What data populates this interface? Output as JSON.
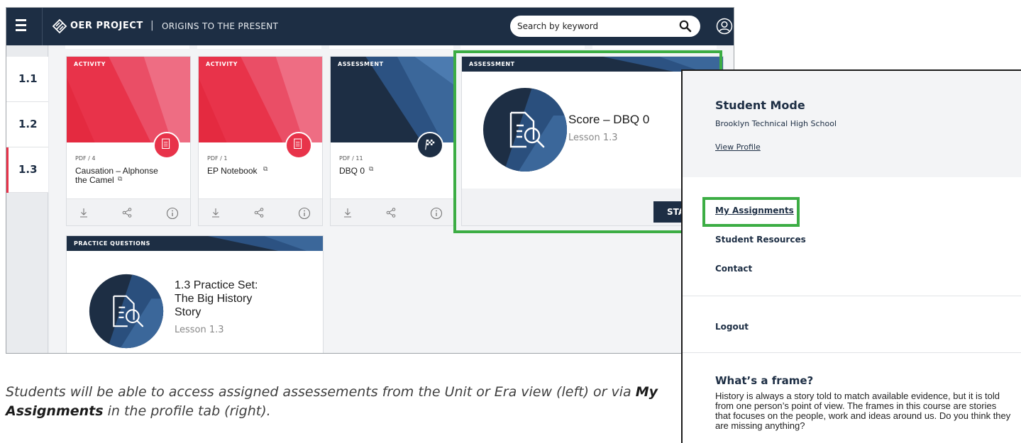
{
  "header": {
    "brand": "OER PROJECT",
    "separator": "|",
    "course": "ORIGINS TO THE PRESENT",
    "search_placeholder": "Search by keyword"
  },
  "sidebar": {
    "items": [
      {
        "label": "1.1",
        "active": false
      },
      {
        "label": "1.2",
        "active": false
      },
      {
        "label": "1.3",
        "active": true
      }
    ]
  },
  "cards": [
    {
      "tag": "ACTIVITY",
      "meta": "PDF / 4",
      "title_line1": "Causation – Alphonse",
      "title_line2": "the Camel",
      "badge_icon": "document-icon"
    },
    {
      "tag": "ACTIVITY",
      "meta": "PDF / 1",
      "title_line1": "EP Notebook",
      "badge_icon": "document-icon"
    },
    {
      "tag": "ASSESSMENT",
      "meta": "PDF / 11",
      "title_line1": "DBQ 0",
      "badge_icon": "checkered-flag-icon"
    }
  ],
  "score_card": {
    "tag": "ASSESSMENT",
    "title": "Score – DBQ 0",
    "lesson": "Lesson 1.3",
    "start_button": "STA"
  },
  "practice_card": {
    "tag": "PRACTICE QUESTIONS",
    "title_line1": "1.3 Practice Set:",
    "title_line2": "The Big History",
    "title_line3": "Story",
    "lesson": "Lesson 1.3"
  },
  "profile_panel": {
    "mode_title": "Student Mode",
    "school": "Brooklyn Technical High School",
    "view_profile": "View Profile",
    "menu": {
      "my_assignments": "My Assignments",
      "student_resources": "Student Resources",
      "contact": "Contact",
      "logout": "Logout"
    },
    "frame_title": "What’s a frame?",
    "frame_text": "History is always a story told to match available evidence, but it is told from one person’s point of view. The frames in this course are stories that focuses on the people, work and ideas around us. Do you think they are missing anything?"
  },
  "caption": {
    "part1": "Students will be able to access assigned assessements from the Unit or Era view (left) or via ",
    "bold": "My Assignments",
    "part2": " in the profile tab (right)."
  },
  "colors": {
    "navy": "#1d2e44",
    "red": "#e8334a",
    "blue": "#3b679a",
    "highlight_green": "#3cad44"
  }
}
